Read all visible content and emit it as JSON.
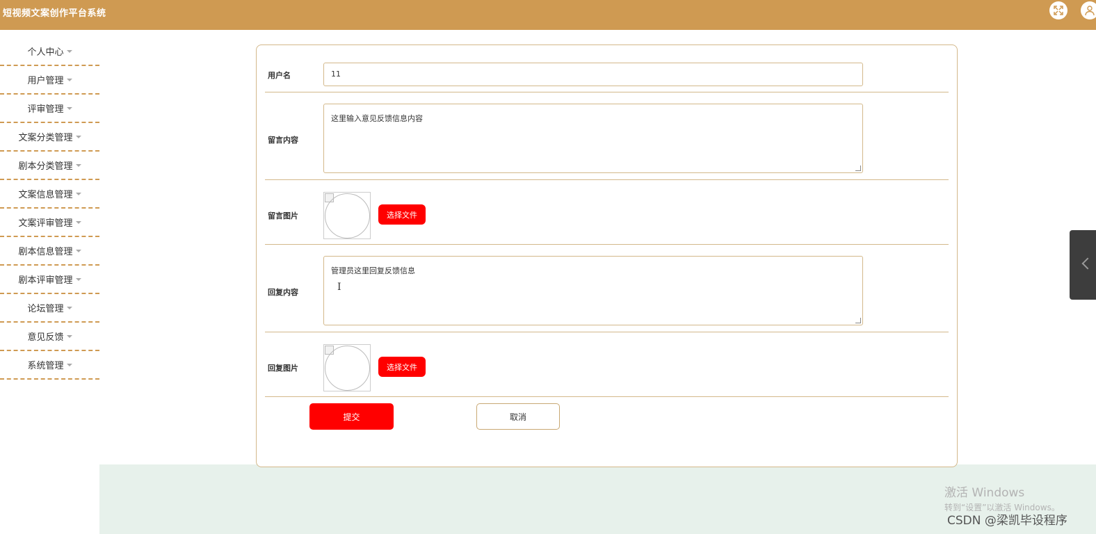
{
  "app": {
    "title": "短视频文案创作平台系统",
    "header_color": "#cf9a52",
    "accent_color": "#ff0000"
  },
  "header": {
    "icons": [
      "fullscreen-icon",
      "user-icon"
    ]
  },
  "sidebar": {
    "items": [
      {
        "label": "个人中心"
      },
      {
        "label": "用户管理"
      },
      {
        "label": "评审管理"
      },
      {
        "label": "文案分类管理"
      },
      {
        "label": "剧本分类管理"
      },
      {
        "label": "文案信息管理"
      },
      {
        "label": "文案评审管理"
      },
      {
        "label": "剧本信息管理"
      },
      {
        "label": "剧本评审管理"
      },
      {
        "label": "论坛管理"
      },
      {
        "label": "意见反馈"
      },
      {
        "label": "系统管理"
      }
    ]
  },
  "form": {
    "username": {
      "label": "用户名",
      "value": "11"
    },
    "message": {
      "label": "留言内容",
      "value": "这里输入意见反馈信息内容"
    },
    "message_image": {
      "label": "留言图片",
      "button": "选择文件"
    },
    "reply": {
      "label": "回复内容",
      "value": "管理员这里回复反馈信息"
    },
    "reply_image": {
      "label": "回复图片",
      "button": "选择文件"
    },
    "submit": "提交",
    "cancel": "取消"
  },
  "overlay": {
    "watermark_line1": "激活 Windows",
    "watermark_line2": "转到“设置”以激活 Windows。",
    "credit": "CSDN @梁凯毕设程序"
  }
}
